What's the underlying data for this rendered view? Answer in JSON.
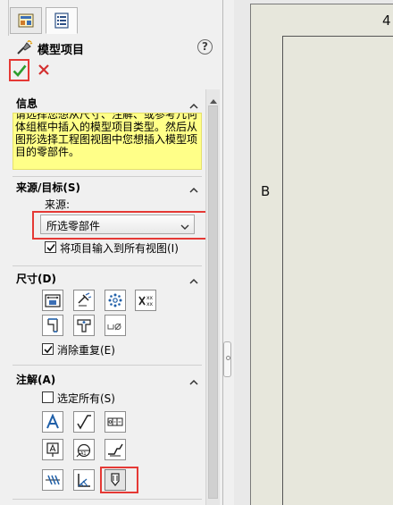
{
  "panel": {
    "tabs": [
      {
        "icon": "feature-manager-tab-icon"
      },
      {
        "icon": "property-manager-tab-icon",
        "active": true
      }
    ],
    "title": "模型项目",
    "title_icon": "model-items-icon",
    "help_icon": "help-icon",
    "help_glyph": "?",
    "confirm_icon": "checkmark-icon",
    "cancel_icon": "close-icon"
  },
  "sections": {
    "info": {
      "title": "信息",
      "text": "请选择您想从尺寸、注解、或参考几何体组框中插入的模型项目类型。然后从图形选择工程图视图中您想插入模型项目的零部件。"
    },
    "source": {
      "title": "来源/目标(S)",
      "source_label": "来源:",
      "selected": "所选零部件",
      "import_all_label": "将项目输入到所有视图(I)",
      "import_all_checked": true
    },
    "dimensions": {
      "title": "尺寸(D)",
      "tool_icons": [
        "marked-for-drawing-icon",
        "not-marked-for-drawing-icon",
        "instance-count-icon",
        "tolerance-dimension-icon",
        "hole-wizard-profile-icon",
        "hole-wizard-location-icon",
        "hole-callout-icon"
      ],
      "eliminate_duplicates_label": "消除重复(E)",
      "eliminate_duplicates_checked": true
    },
    "annotations": {
      "title": "注解(A)",
      "select_all_label": "选定所有(S)",
      "select_all_checked": false,
      "tool_icons": [
        "note-icon",
        "surface-finish-icon",
        "geometric-tolerance-icon",
        "balloon-icon",
        "datum-target-icon",
        "weld-symbol-icon",
        "cosmetic-thread-icon",
        "datum-feature-icon",
        "caterpillar-icon"
      ]
    }
  },
  "drawing": {
    "zone_row": "B",
    "zone_column": "4"
  },
  "colors": {
    "accent_red": "#e53935",
    "confirm_green": "#2e9e2e",
    "info_yellow": "#ffff88"
  }
}
